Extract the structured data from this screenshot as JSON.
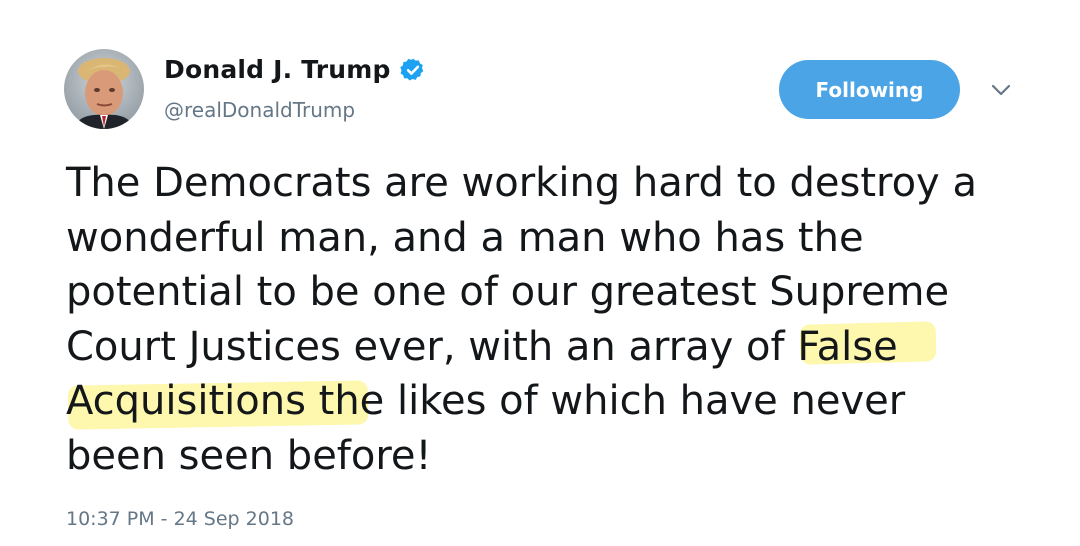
{
  "tweet": {
    "author": {
      "name": "Donald J. Trump",
      "handle": "@realDonaldTrump",
      "verified": true,
      "avatar": "profile-photo"
    },
    "follow_button_label": "Following",
    "menu_icon": "chevron-down-icon",
    "text_lines": [
      "The Democrats are working hard to destroy a",
      "wonderful man, and a man who has the",
      "potential to be one of our greatest Supreme",
      "Court Justices ever, with an array of False",
      "Acquisitions the likes of which have never",
      "been seen before!"
    ],
    "highlighted_text": "False Acquisitions th",
    "timestamp": "10:37 PM - 24 Sep 2018"
  },
  "colors": {
    "accent": "#4aa4e6",
    "verified_badge": "#1da1f2",
    "secondary_text": "#657786",
    "primary_text": "#14171a",
    "highlight": "#fdf178"
  }
}
